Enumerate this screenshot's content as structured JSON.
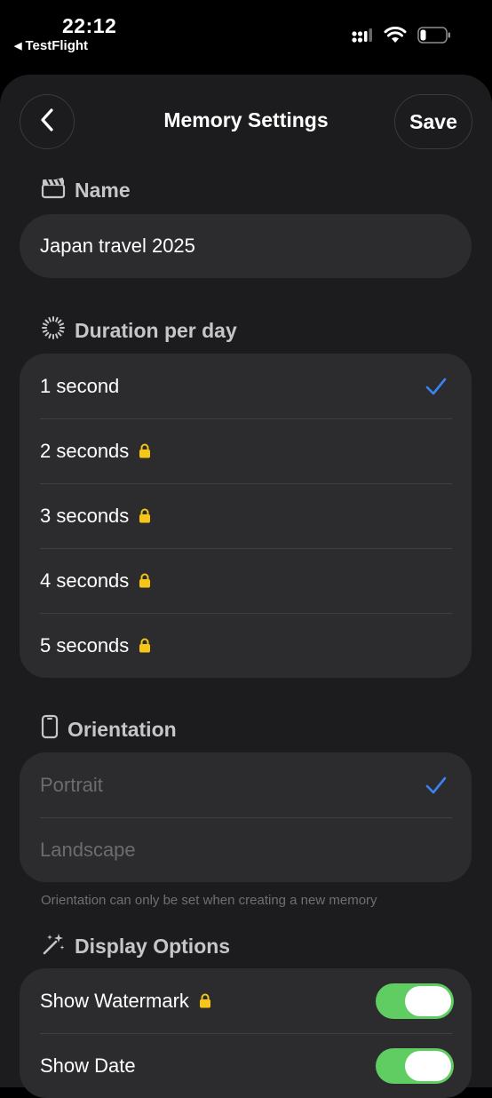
{
  "status_bar": {
    "time": "22:12",
    "back_app": "TestFlight",
    "icons": [
      "cellular-signal-icon",
      "wifi-icon",
      "battery-icon"
    ]
  },
  "header": {
    "title": "Memory Settings",
    "save_label": "Save",
    "back_icon": "chevron-left-icon"
  },
  "name_section": {
    "label": "Name",
    "icon": "clapperboard-icon",
    "value": "Japan travel 2025"
  },
  "duration_section": {
    "label": "Duration per day",
    "icon": "timer-dial-icon",
    "options": [
      {
        "label": "1 second",
        "selected": true,
        "locked": false
      },
      {
        "label": "2 seconds",
        "selected": false,
        "locked": true
      },
      {
        "label": "3 seconds",
        "selected": false,
        "locked": true
      },
      {
        "label": "4 seconds",
        "selected": false,
        "locked": true
      },
      {
        "label": "5 seconds",
        "selected": false,
        "locked": true
      }
    ]
  },
  "orientation_section": {
    "label": "Orientation",
    "icon": "phone-portrait-icon",
    "options": [
      {
        "label": "Portrait",
        "selected": true
      },
      {
        "label": "Landscape",
        "selected": false
      }
    ],
    "footnote": "Orientation can only be set when creating a new memory"
  },
  "display_section": {
    "label": "Display Options",
    "icon": "magic-wand-icon",
    "options": [
      {
        "label": "Show Watermark",
        "locked": true,
        "enabled": true
      },
      {
        "label": "Show Date",
        "locked": false,
        "enabled": true
      }
    ]
  },
  "colors": {
    "accent_check": "#3b82f6",
    "lock": "#f5c518",
    "toggle_on": "#60cd63",
    "card_bg": "#2c2c2e",
    "sheet_bg": "#1c1c1e"
  }
}
